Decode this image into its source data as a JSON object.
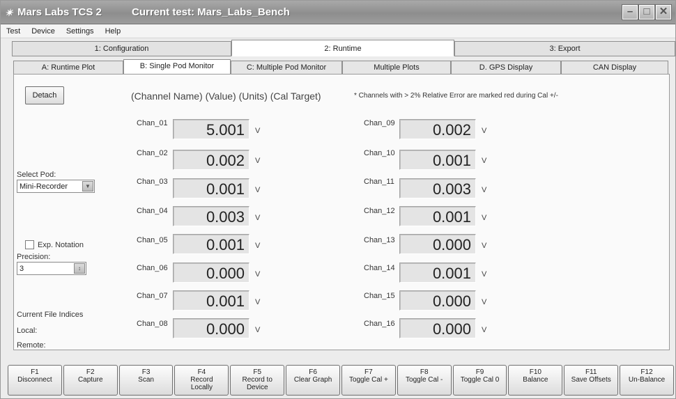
{
  "window": {
    "app_title": "Mars Labs TCS 2",
    "test_title": "Current test: Mars_Labs_Bench",
    "app_icon": "mars-logo-icon",
    "controls": [
      "minimize-icon",
      "maximize-icon",
      "close-icon"
    ]
  },
  "menu": [
    "Test",
    "Device",
    "Settings",
    "Help"
  ],
  "top_tabs": [
    {
      "label": "1: Configuration",
      "active": false
    },
    {
      "label": "2: Runtime",
      "active": true
    },
    {
      "label": "3: Export",
      "active": false
    }
  ],
  "sub_tabs": [
    {
      "label": "A: Runtime Plot",
      "active": false
    },
    {
      "label": "B: Single Pod Monitor",
      "active": true
    },
    {
      "label": "C: Multiple Pod Monitor",
      "active": false
    },
    {
      "label": "Multiple Plots",
      "active": false
    },
    {
      "label": "D. GPS Display",
      "active": false
    },
    {
      "label": "CAN Display",
      "active": false
    }
  ],
  "monitor": {
    "detach_label": "Detach",
    "header": "(Channel Name)  (Value)  (Units)  (Cal Target)",
    "note": "* Channels with > 2% Relative Error are marked red during Cal +/-",
    "select_pod_label": "Select Pod:",
    "select_pod_value": "Mini-Recorder",
    "exp_notation_label": "Exp. Notation",
    "exp_notation_checked": false,
    "precision_label": "Precision:",
    "precision_value": "3",
    "file_indices_label": "Current File Indices",
    "local_label": "Local:",
    "remote_label": "Remote:"
  },
  "channels": [
    {
      "name": "Chan_01",
      "value": "5.001",
      "unit": "V"
    },
    {
      "name": "Chan_02",
      "value": "0.002",
      "unit": "V"
    },
    {
      "name": "Chan_03",
      "value": "0.001",
      "unit": "V"
    },
    {
      "name": "Chan_04",
      "value": "0.003",
      "unit": "V"
    },
    {
      "name": "Chan_05",
      "value": "0.001",
      "unit": "V"
    },
    {
      "name": "Chan_06",
      "value": "0.000",
      "unit": "V"
    },
    {
      "name": "Chan_07",
      "value": "0.001",
      "unit": "V"
    },
    {
      "name": "Chan_08",
      "value": "0.000",
      "unit": "V"
    },
    {
      "name": "Chan_09",
      "value": "0.002",
      "unit": "V"
    },
    {
      "name": "Chan_10",
      "value": "0.001",
      "unit": "V"
    },
    {
      "name": "Chan_11",
      "value": "0.003",
      "unit": "V"
    },
    {
      "name": "Chan_12",
      "value": "0.001",
      "unit": "V"
    },
    {
      "name": "Chan_13",
      "value": "0.000",
      "unit": "V"
    },
    {
      "name": "Chan_14",
      "value": "0.001",
      "unit": "V"
    },
    {
      "name": "Chan_15",
      "value": "0.000",
      "unit": "V"
    },
    {
      "name": "Chan_16",
      "value": "0.000",
      "unit": "V"
    }
  ],
  "fkeys": [
    {
      "key": "F1",
      "label": "Disconnect"
    },
    {
      "key": "F2",
      "label": "Capture"
    },
    {
      "key": "F3",
      "label": "Scan"
    },
    {
      "key": "F4",
      "label": "Record\nLocally"
    },
    {
      "key": "F5",
      "label": "Record to\nDevice"
    },
    {
      "key": "F6",
      "label": "Clear Graph"
    },
    {
      "key": "F7",
      "label": "Toggle Cal +"
    },
    {
      "key": "F8",
      "label": "Toggle Cal -"
    },
    {
      "key": "F9",
      "label": "Toggle Cal 0"
    },
    {
      "key": "F10",
      "label": "Balance"
    },
    {
      "key": "F11",
      "label": "Save Offsets"
    },
    {
      "key": "F12",
      "label": "Un-Balance"
    }
  ]
}
